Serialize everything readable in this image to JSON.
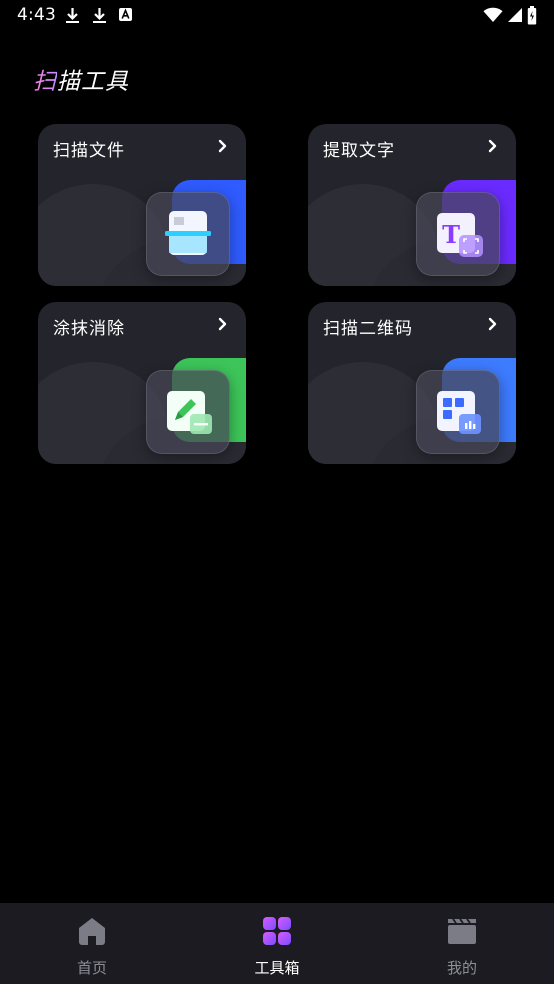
{
  "status_bar": {
    "time": "4:43",
    "left_icons": [
      "download-icon",
      "download-icon",
      "font-icon"
    ],
    "right_icons": [
      "wifi-icon",
      "signal-icon",
      "battery-icon"
    ]
  },
  "header": {
    "title_first_char": "扫",
    "title_rest": "描工具"
  },
  "tools": [
    {
      "label": "扫描文件",
      "icon": "document-scan-icon",
      "accent": "#2f5bff"
    },
    {
      "label": "提取文字",
      "icon": "text-extract-icon",
      "accent": "#6a2bff"
    },
    {
      "label": "涂抹消除",
      "icon": "erase-pencil-icon",
      "accent": "#3dc55a"
    },
    {
      "label": "扫描二维码",
      "icon": "qr-code-icon",
      "accent": "#3d7bff"
    }
  ],
  "bottom_nav": [
    {
      "label": "首页",
      "icon": "home-icon",
      "active": false
    },
    {
      "label": "工具箱",
      "icon": "toolbox-icon",
      "active": true
    },
    {
      "label": "我的",
      "icon": "film-icon",
      "active": false
    }
  ],
  "colors": {
    "background": "#000000",
    "card": "#24242c",
    "nav_background": "#1b1b21",
    "nav_active_accent": "#a35cff"
  }
}
